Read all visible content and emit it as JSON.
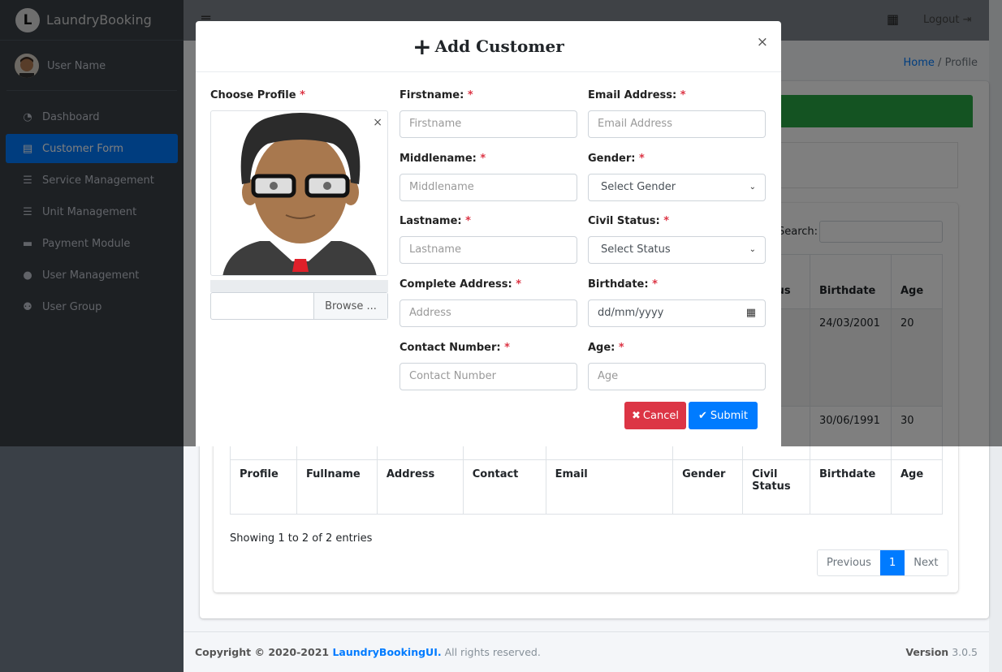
{
  "sidebar": {
    "brand": "LaundryBooking",
    "brand_letter": "L",
    "user_name": "User Name",
    "items": [
      {
        "label": "Dashboard",
        "icon": "tachometer-icon",
        "glyph": "◔"
      },
      {
        "label": "Customer Form",
        "icon": "id-card-icon",
        "glyph": "▤",
        "active": true
      },
      {
        "label": "Service Management",
        "icon": "list-icon",
        "glyph": "☰"
      },
      {
        "label": "Unit Management",
        "icon": "list-icon",
        "glyph": "☰"
      },
      {
        "label": "Payment Module",
        "icon": "money-bill-icon",
        "glyph": "▬"
      },
      {
        "label": "User Management",
        "icon": "user-icon",
        "glyph": "●"
      },
      {
        "label": "User Group",
        "icon": "users-icon",
        "glyph": "⚉"
      }
    ]
  },
  "navbar": {
    "menu_glyph": "≡",
    "apps_glyph": "▦",
    "logout": "Logout",
    "logout_glyph": "⇥"
  },
  "breadcrumb": {
    "home": "Home",
    "sep": "/",
    "current": "Profile"
  },
  "table": {
    "search_label": "Search:",
    "columns": [
      "Profile",
      "Fullname",
      "Address",
      "Contact",
      "Email",
      "Gender",
      "Civil Status",
      "Birthdate",
      "Age"
    ],
    "rows": [
      {
        "birthdate": "24/03/2001",
        "age": "20"
      },
      {
        "birthdate": "30/06/1991",
        "age": "30"
      }
    ],
    "info": "Showing 1 to 2 of 2 entries",
    "pagination": {
      "previous": "Previous",
      "current": "1",
      "next": "Next"
    }
  },
  "footer": {
    "copyright": "Copyright © 2020-2021 ",
    "brand_link": "LaundryBookingUI.",
    "rights": " All rights reserved.",
    "version_label": "Version",
    "version": "3.0.5"
  },
  "modal": {
    "title": "Add Customer",
    "title_glyph": "+",
    "close": "×",
    "req": "*",
    "profile_label": "Choose Profile",
    "image_close": "×",
    "browse": "Browse ...",
    "fields": {
      "firstname": {
        "label": "Firstname:",
        "placeholder": "Firstname"
      },
      "middlename": {
        "label": "Middlename:",
        "placeholder": "Middlename"
      },
      "lastname": {
        "label": "Lastname:",
        "placeholder": "Lastname"
      },
      "address": {
        "label": "Complete Address:",
        "placeholder": "Address"
      },
      "contact": {
        "label": "Contact Number:",
        "placeholder": "Contact Number"
      },
      "email": {
        "label": "Email Address:",
        "placeholder": "Email Address"
      },
      "gender": {
        "label": "Gender:",
        "value": "Select Gender"
      },
      "civil": {
        "label": "Civil Status:",
        "value": "Select Status"
      },
      "birthdate": {
        "label": "Birthdate:",
        "placeholder": "dd/mm/yyyy"
      },
      "age": {
        "label": "Age:",
        "placeholder": "Age"
      }
    },
    "cancel": "Cancel",
    "cancel_glyph": "✖",
    "submit": "Submit",
    "submit_glyph": "✔"
  },
  "colors": {
    "primary": "#007bff",
    "success": "#28a745",
    "danger": "#dc3545",
    "sidebar": "#343a40"
  }
}
